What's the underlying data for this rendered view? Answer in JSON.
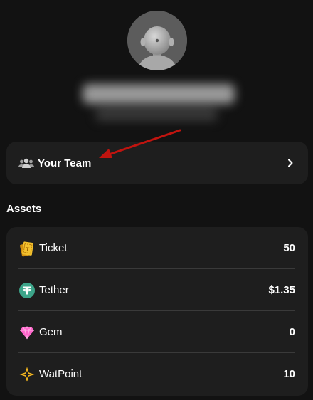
{
  "profile": {
    "avatar_icon": "robot-avatar-icon",
    "name_redacted": true
  },
  "team": {
    "label": "Your Team",
    "icon": "people-icon",
    "chevron": "chevron-right-icon"
  },
  "annotation": {
    "arrow_color": "#c0140f"
  },
  "assets": {
    "title": "Assets",
    "items": [
      {
        "name": "Ticket",
        "value": "50",
        "icon": "ticket-icon"
      },
      {
        "name": "Tether",
        "value": "$1.35",
        "icon": "tether-icon"
      },
      {
        "name": "Gem",
        "value": "0",
        "icon": "gem-icon"
      },
      {
        "name": "WatPoint",
        "value": "10",
        "icon": "watpoint-icon"
      }
    ]
  },
  "colors": {
    "background": "#121212",
    "card": "#1e1e1e",
    "divider": "#3a3a3a",
    "tether_green": "#3da58a",
    "gem_pink": "#ff66cc",
    "gold": "#f2b51f"
  }
}
